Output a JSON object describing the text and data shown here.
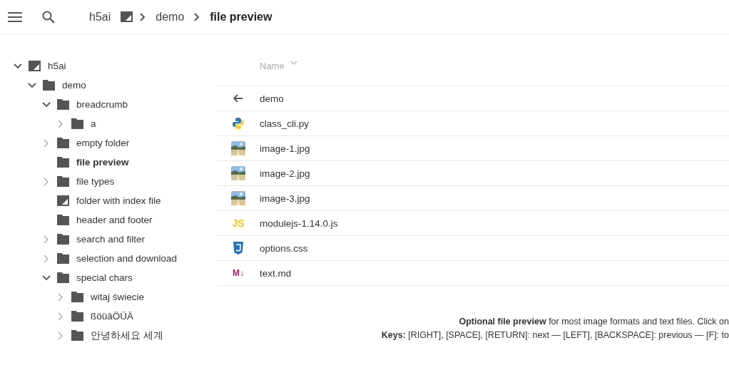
{
  "header": {
    "breadcrumb": [
      {
        "label": "h5ai",
        "kind": "root"
      },
      {
        "label": "demo",
        "kind": "folder"
      },
      {
        "label": "file preview",
        "kind": "current"
      }
    ]
  },
  "tree": [
    {
      "label": "h5ai",
      "kind": "index",
      "expandable": true,
      "expanded": true,
      "current": false,
      "children": [
        {
          "label": "demo",
          "kind": "folder",
          "expandable": true,
          "expanded": true,
          "current": false,
          "children": [
            {
              "label": "breadcrumb",
              "kind": "folder",
              "expandable": true,
              "expanded": true,
              "current": false,
              "children": [
                {
                  "label": "a",
                  "kind": "folder",
                  "expandable": true,
                  "expanded": false,
                  "current": false
                }
              ]
            },
            {
              "label": "empty folder",
              "kind": "folder",
              "expandable": true,
              "expanded": false,
              "current": false
            },
            {
              "label": "file preview",
              "kind": "folder",
              "expandable": false,
              "expanded": false,
              "current": true
            },
            {
              "label": "file types",
              "kind": "folder",
              "expandable": true,
              "expanded": false,
              "current": false
            },
            {
              "label": "folder with index file",
              "kind": "index",
              "expandable": false,
              "expanded": false,
              "current": false
            },
            {
              "label": "header and footer",
              "kind": "folder",
              "expandable": false,
              "expanded": false,
              "current": false
            },
            {
              "label": "search and filter",
              "kind": "folder",
              "expandable": true,
              "expanded": false,
              "current": false
            },
            {
              "label": "selection and download",
              "kind": "folder",
              "expandable": true,
              "expanded": false,
              "current": false
            },
            {
              "label": "special chars",
              "kind": "folder",
              "expandable": true,
              "expanded": true,
              "current": false,
              "children": [
                {
                  "label": "witaj świecie",
                  "kind": "folder",
                  "expandable": true,
                  "expanded": false,
                  "current": false
                },
                {
                  "label": "ßöüäÖÜÄ",
                  "kind": "folder",
                  "expandable": true,
                  "expanded": false,
                  "current": false
                },
                {
                  "label": "안녕하세요 세계",
                  "kind": "folder",
                  "expandable": true,
                  "expanded": false,
                  "current": false
                }
              ]
            }
          ]
        }
      ]
    }
  ],
  "list": {
    "column": "Name",
    "files": [
      {
        "name": "demo",
        "kind": "back"
      },
      {
        "name": "class_cli.py",
        "kind": "python"
      },
      {
        "name": "image-1.jpg"
      },
      {
        "name": "image-2.jpg"
      },
      {
        "name": "image-3.jpg"
      },
      {
        "name": "modulejs-1.14.0.js",
        "kind": "js",
        "glyph": "JS"
      },
      {
        "name": "options.css",
        "kind": "css"
      },
      {
        "name": "text.md",
        "kind": "markdown",
        "glyph": "M↓"
      }
    ]
  },
  "info": [
    "**Optional file preview** for most image formats and text files. Click on",
    "**Keys:** [RIGHT], [SPACE], [RETURN]: next — [LEFT], [BACKSPACE]: previous — [F]: to"
  ]
}
